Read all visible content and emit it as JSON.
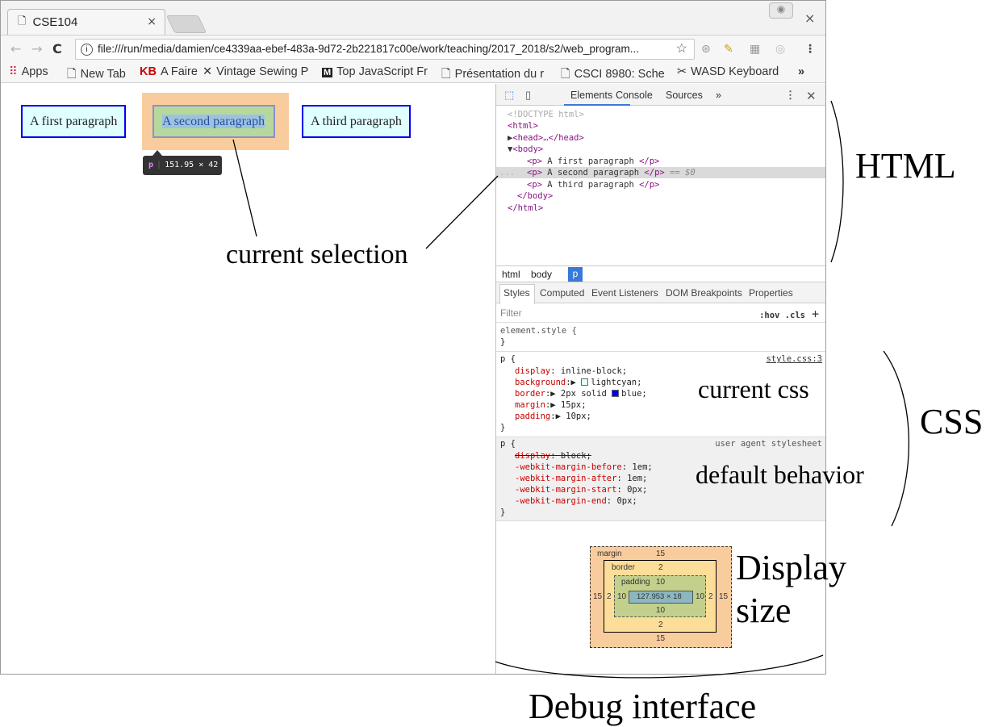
{
  "browser": {
    "tab_title": "CSE104",
    "tab_close": "×",
    "window_close": "×",
    "url": "file:///run/media/damien/ce4339aa-ebef-483a-9d72-2b221817c00e/work/teaching/2017_2018/s2/web_program...",
    "bookmarks": [
      {
        "icon": "apps-icon",
        "label": "Apps"
      },
      {
        "icon": "page-icon",
        "label": "New Tab"
      },
      {
        "icon": "kb-icon",
        "label": "A Faire"
      },
      {
        "icon": "scissors-icon",
        "label": "Vintage Sewing P"
      },
      {
        "icon": "medium-icon",
        "label": "Top JavaScript Fr"
      },
      {
        "icon": "page-icon",
        "label": "Présentation du r"
      },
      {
        "icon": "page-icon",
        "label": "CSCI 8980: Sche"
      },
      {
        "icon": "wasd-icon",
        "label": "WASD Keyboard"
      }
    ],
    "bookmarks_more": "»"
  },
  "page": {
    "paragraphs": [
      "A first paragraph",
      "A second paragraph",
      "A third paragraph"
    ],
    "tooltip_tag": "p",
    "tooltip_size": "151.95 × 42"
  },
  "devtools": {
    "tabs": [
      "Elements",
      "Console",
      "Sources"
    ],
    "tabs_more": "»",
    "dom": {
      "doctype": "<!DOCTYPE html>",
      "html_open": "<html>",
      "head": "<head>…</head>",
      "body_open": "<body>",
      "p1": "A first paragraph",
      "p2": "A second paragraph",
      "p2_marker": "== $0",
      "p3": "A third paragraph",
      "body_close": "</body>",
      "html_close": "</html>",
      "ellipsis": "..."
    },
    "breadcrumbs": [
      "html",
      "body",
      "p"
    ],
    "style_tabs": [
      "Styles",
      "Computed",
      "Event Listeners",
      "DOM Breakpoints",
      "Properties"
    ],
    "filter_placeholder": "Filter",
    "filter_tools": ":hov  .cls",
    "filter_plus": "+",
    "element_style": "element.style {",
    "close_brace": "}",
    "rule1": {
      "selector": "p {",
      "source": "style.css:3",
      "decls": [
        {
          "prop": "display",
          "val": "inline-block;"
        },
        {
          "prop": "background",
          "val": "lightcyan;",
          "swatch": "#e0ffff"
        },
        {
          "prop": "border",
          "val": "2px solid ",
          "val2": "blue;",
          "swatch": "#0000ee"
        },
        {
          "prop": "margin",
          "val": "15px;"
        },
        {
          "prop": "padding",
          "val": "10px;"
        }
      ]
    },
    "rule2": {
      "selector": "p {",
      "source": "user agent stylesheet",
      "decls": [
        {
          "prop": "display",
          "val": "block;"
        },
        {
          "prop": "-webkit-margin-before",
          "val": "1em;"
        },
        {
          "prop": "-webkit-margin-after",
          "val": "1em;"
        },
        {
          "prop": "-webkit-margin-start",
          "val": "0px;"
        },
        {
          "prop": "-webkit-margin-end",
          "val": "0px;"
        }
      ]
    },
    "boxmodel": {
      "margin_label": "margin",
      "border_label": "border",
      "padding_label": "padding",
      "margin_top": "15",
      "margin_bottom": "15",
      "margin_left": "15",
      "margin_right": "15",
      "border_top": "2",
      "border_bottom": "2",
      "border_left": "2",
      "border_right": "2",
      "padding_top": "10",
      "padding_bottom": "10",
      "padding_left": "10",
      "padding_right": "10",
      "content": "127.953 × 18"
    }
  },
  "annotations": {
    "html": "HTML",
    "current_selection": "current selection",
    "current_css": "current css",
    "css": "CSS",
    "default_behavior": "default behavior",
    "display_size_1": "Display",
    "display_size_2": "size",
    "debug_interface": "Debug interface"
  }
}
